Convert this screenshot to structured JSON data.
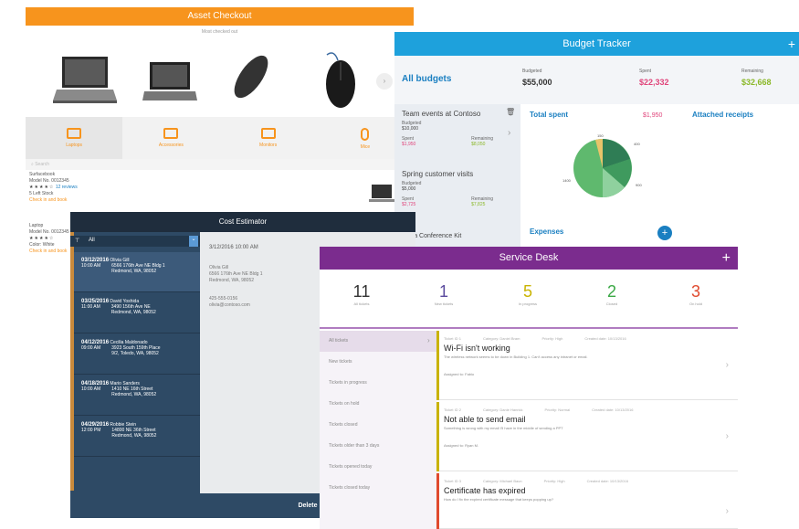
{
  "asset": {
    "title": "Asset Checkout",
    "subtitle": "Most checked out",
    "categories": [
      {
        "label": "Laptops",
        "icon": "laptop-icon"
      },
      {
        "label": "Accessories",
        "icon": "keyboard-icon"
      },
      {
        "label": "Monitors",
        "icon": "monitor-icon"
      },
      {
        "label": "Mice",
        "icon": "mouse-icon"
      }
    ],
    "search_placeholder": "Search",
    "items": [
      {
        "name": "Surfacebook",
        "model": "Model No. 0012345",
        "stars": "★★★★☆",
        "reviews": "12 reviews",
        "stock": "5 Left Stock",
        "link": "Check in and book"
      },
      {
        "name": "Laptop",
        "model": "Model No. 0012345",
        "stars": "★★★★☆",
        "reviews": "",
        "stock": "Color: White",
        "link": "Check in and book"
      }
    ]
  },
  "budget": {
    "title": "Budget Tracker",
    "plus": "+",
    "section": "All budgets",
    "budgeted_label": "Budgeted",
    "budgeted_value": "$55,000",
    "spent_label": "Spent",
    "spent_value": "$22,332",
    "remaining_label": "Remaining",
    "remaining_value": "$32,668",
    "cards": [
      {
        "title": "Team events at Contoso",
        "budget_label": "Budgeted",
        "budget": "$10,000",
        "spent_label": "Spent",
        "spent": "$1,950",
        "remaining_label": "Remaining",
        "remaining": "$8,050"
      },
      {
        "title": "Spring customer visits",
        "budget_label": "Budgeted",
        "budget": "$5,000",
        "spent_label": "Spent",
        "spent": "$2,725",
        "remaining_label": "Remaining",
        "remaining": "$7,825"
      }
    ],
    "next_card": "Mesa Conference Kit",
    "total_spent_label": "Total spent",
    "total_spent_value": "$1,950",
    "receipts_label": "Attached receipts",
    "expenses_label": "Expenses",
    "add": "+",
    "pie_labels": [
      "150",
      "400",
      "900",
      "1400"
    ]
  },
  "cost": {
    "title": "Cost Estimator",
    "filter": "All",
    "rows": [
      {
        "date": "03/12/2016",
        "name": "Olivia Gill",
        "time": "10:00 AM",
        "addr1": "6566 176th Ave NE Bldg 1",
        "addr2": "Redmond, WA, 98052"
      },
      {
        "date": "03/25/2016",
        "name": "David Yoshida",
        "time": "11:00 AM",
        "addr1": "3490 156th Ave NE",
        "addr2": "Redmond, WA, 98052"
      },
      {
        "date": "04/12/2016",
        "name": "Cecilia Maldonado",
        "time": "09:00 AM",
        "addr1": "3923 South 159th Place",
        "addr2": "9/2, Toledo, WA, 98052"
      },
      {
        "date": "04/18/2016",
        "name": "Mario Sanders",
        "time": "10:00 AM",
        "addr1": "1410 NE 16th Street",
        "addr2": "Redmond, WA, 98052"
      },
      {
        "date": "04/29/2016",
        "name": "Robbie Stein",
        "time": "12:00 PM",
        "addr1": "14800 NE 36th Street",
        "addr2": "Redmond, WA, 98052"
      }
    ],
    "detail": {
      "datetime": "3/12/2016 10:00 AM",
      "client": "Olivia Gill",
      "address": "6566 176th Ave NE Bldg 1",
      "city": "Redmond, WA, 98052",
      "phone": "425-555-0156",
      "email": "olivia@contoso.com"
    },
    "delete_label": "Delete"
  },
  "service": {
    "title": "Service Desk",
    "plus": "+",
    "stats": [
      {
        "num": "11",
        "label": "All tickets",
        "color": "#333333"
      },
      {
        "num": "1",
        "label": "New tickets",
        "color": "#5b4b9e"
      },
      {
        "num": "5",
        "label": "In progress",
        "color": "#c9b300"
      },
      {
        "num": "2",
        "label": "Closed",
        "color": "#3aa845"
      },
      {
        "num": "3",
        "label": "On hold",
        "color": "#e04a2e"
      }
    ],
    "filters": [
      "All tickets",
      "New tickets",
      "Tickets in progress",
      "Tickets on hold",
      "Tickets closed",
      "Tickets older than 3 days",
      "Tickets opened today",
      "Tickets closed today"
    ],
    "tickets": [
      {
        "title": "Wi-Fi isn't working",
        "desc": "The wireless network seems to be down in Building 1. Can't access any intranet or email.",
        "assigned": "Assigned to: Fabio",
        "meta1": "Ticket ID 1",
        "meta2": "Category: Daniel Bram",
        "meta3": "Priority: High",
        "meta4": "Created date: 10/13/2016",
        "bar": "#c9b300"
      },
      {
        "title": "Not able to send email",
        "desc": "Something is wrong with my email I'll have in the middle of sending a PPT",
        "assigned": "Assigned to: Ryan M.",
        "meta1": "Ticket ID 2",
        "meta2": "Category: Danie Hanrick",
        "meta3": "Priority: Normal",
        "meta4": "Created date: 10/13/2016",
        "bar": "#c9b300"
      },
      {
        "title": "Certificate has expired",
        "desc": "How do I fix the expired certificate message that keeps popping up?",
        "assigned": "",
        "meta1": "Ticket ID 3",
        "meta2": "Category: Michael Baun",
        "meta3": "Priority: High",
        "meta4": "Created date: 10/13/2016",
        "bar": "#e04a2e"
      }
    ]
  }
}
